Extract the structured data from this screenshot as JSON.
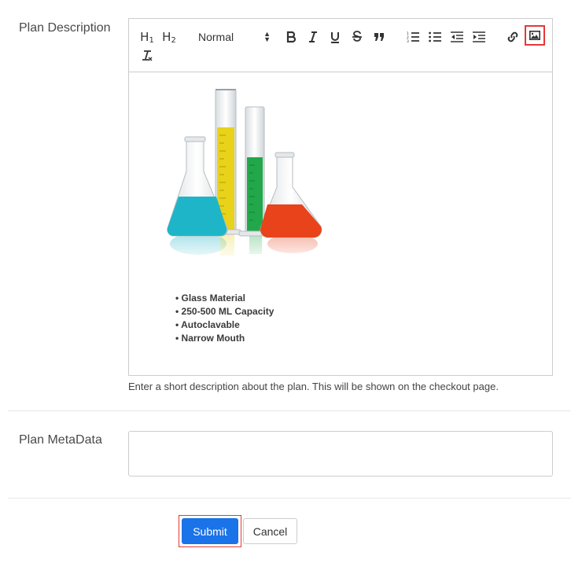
{
  "description_field": {
    "label": "Plan Description",
    "toolbar": {
      "header1": "H1",
      "header2": "H2",
      "format_select": "Normal",
      "highlighted_tool": "image-icon"
    },
    "content": {
      "image_alt": "laboratory glassware",
      "bullets": [
        "Glass Material",
        "250-500 ML Capacity",
        "Autoclavable",
        "Narrow Mouth"
      ]
    },
    "help_text": "Enter a short description about the plan. This will be shown on the checkout page."
  },
  "metadata_field": {
    "label": "Plan MetaData",
    "value": ""
  },
  "actions": {
    "submit_label": "Submit",
    "cancel_label": "Cancel"
  },
  "colors": {
    "submit_bg": "#1a73e8",
    "highlight": "#e53935",
    "liquid_cyan": "#1fb5c8",
    "liquid_yellow": "#e8d21a",
    "liquid_green": "#22a84a",
    "liquid_orange": "#e8431a"
  }
}
